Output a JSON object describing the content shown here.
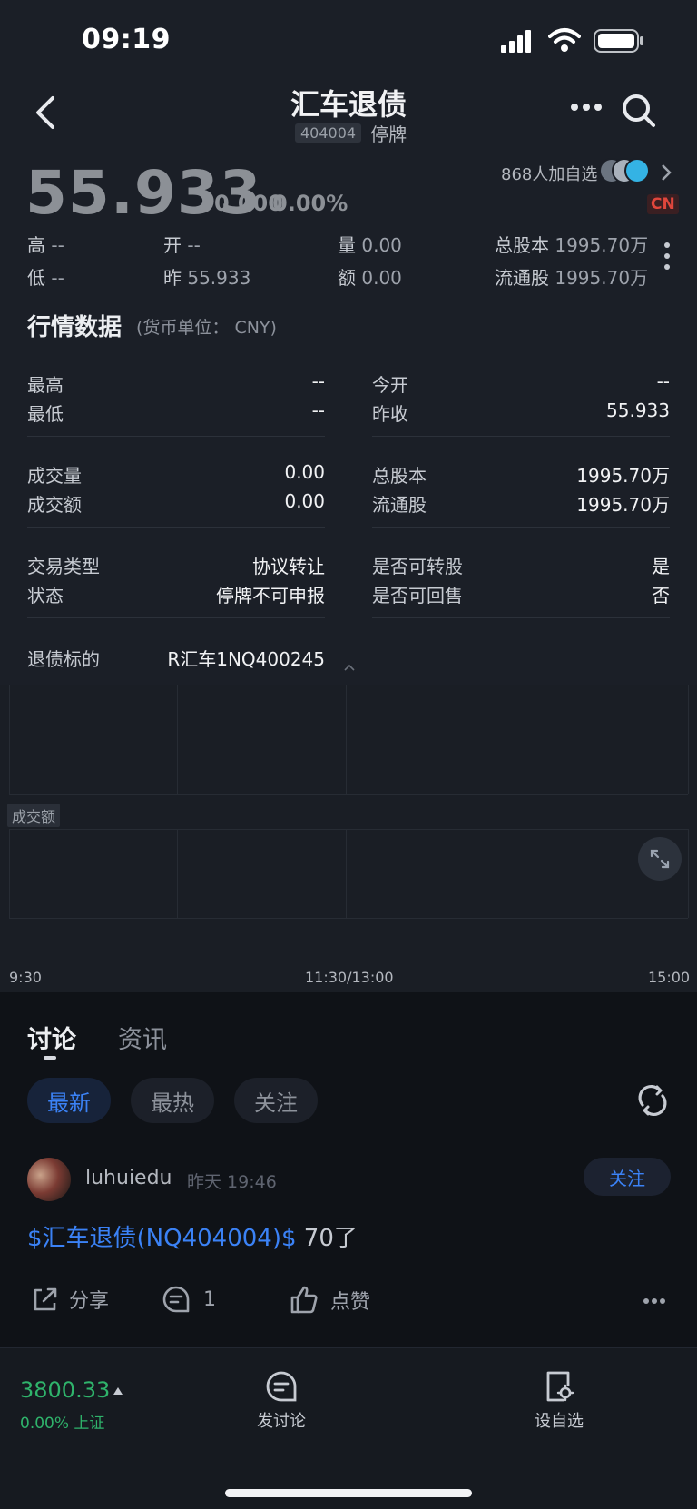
{
  "status_bar": {
    "time": "09:19"
  },
  "header": {
    "title": "汇车退债",
    "code": "404004",
    "status": "停牌"
  },
  "quote": {
    "price": "55.933",
    "change": "0.000",
    "change_pct": "0.00%",
    "watchers": "868人加自选",
    "market_badge": "CN",
    "high_label": "高",
    "high_value": "--",
    "low_label": "低",
    "low_value": "--",
    "open_label": "开",
    "open_value": "--",
    "prev_label": "昨",
    "prev_value": "55.933",
    "vol_label": "量",
    "vol_value": "0.00",
    "amt_label": "额",
    "amt_value": "0.00",
    "total_label": "总股本",
    "total_value": "1995.70万",
    "float_label": "流通股",
    "float_value": "1995.70万"
  },
  "market_data": {
    "title": "行情数据",
    "currency": "(货币单位： CNY)",
    "rows": [
      {
        "l_label": "最高",
        "l_value": "--",
        "r_label": "今开",
        "r_value": "--"
      },
      {
        "l_label": "最低",
        "l_value": "--",
        "r_label": "昨收",
        "r_value": "55.933"
      },
      {
        "l_label": "成交量",
        "l_value": "0.00",
        "r_label": "总股本",
        "r_value": "1995.70万"
      },
      {
        "l_label": "成交额",
        "l_value": "0.00",
        "r_label": "流通股",
        "r_value": "1995.70万"
      },
      {
        "l_label": "交易类型",
        "l_value": "协议转让",
        "r_label": "是否可转股",
        "r_value": "是"
      },
      {
        "l_label": "状态",
        "l_value": "停牌不可申报",
        "r_label": "是否可回售",
        "r_value": "否"
      }
    ],
    "underlying_label": "退债标的",
    "underlying_value": "R汇车1NQ400245"
  },
  "chart": {
    "volume_tag": "成交额",
    "x_start": "9:30",
    "x_mid": "11:30/13:00",
    "x_end": "15:00"
  },
  "discussion": {
    "tabs": [
      "讨论",
      "资讯"
    ],
    "filters": [
      "最新",
      "最热",
      "关注"
    ],
    "post": {
      "user": "luhuiedu",
      "time": "昨天 19:46",
      "follow": "关注",
      "tag": "$汇车退债(NQ404004)$",
      "text": " 70了",
      "share": "分享",
      "comments": "1",
      "like": "点赞"
    }
  },
  "footer": {
    "index_value": "3800.33",
    "index_change": "0.00%",
    "index_name": "上证",
    "post_label": "发讨论",
    "watch_label": "设自选"
  },
  "colors": {
    "accent": "#3b82f6",
    "badge_red": "#e0463c",
    "index_green": "#2fb36b"
  }
}
